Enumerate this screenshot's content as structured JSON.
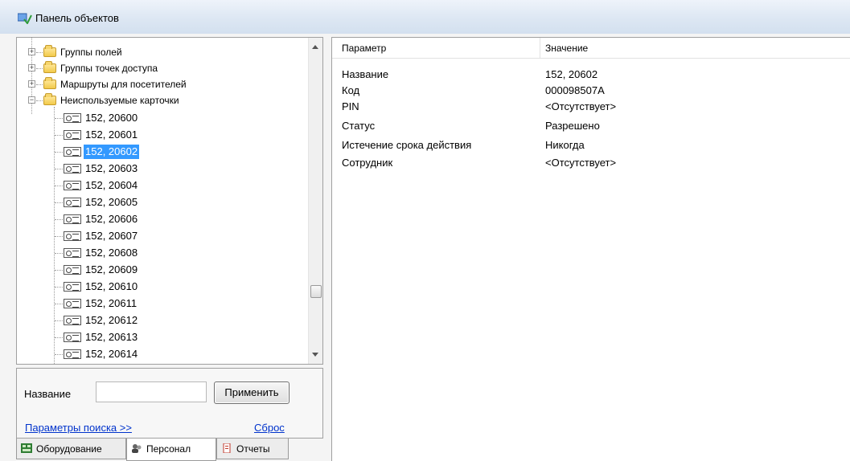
{
  "window": {
    "title": "Панель объектов",
    "icon": "panel-icon"
  },
  "tree": {
    "folders": [
      {
        "label": "Группы полей",
        "expanded": false
      },
      {
        "label": "Группы точек доступа",
        "expanded": false
      },
      {
        "label": "Маршруты для посетителей",
        "expanded": false
      },
      {
        "label": "Неиспользуемые карточки",
        "expanded": true
      }
    ],
    "cards": [
      "152, 20600",
      "152, 20601",
      "152, 20602",
      "152, 20603",
      "152, 20604",
      "152, 20605",
      "152, 20606",
      "152, 20607",
      "152, 20608",
      "152, 20609",
      "152, 20610",
      "152, 20611",
      "152, 20612",
      "152, 20613",
      "152, 20614"
    ],
    "selected_card": "152, 20602"
  },
  "search": {
    "name_label": "Название",
    "name_value": "",
    "apply_label": "Применить",
    "params_link": "Параметры поиска >>",
    "reset_link": "Сброс"
  },
  "tabs": [
    {
      "label": "Оборудование",
      "icon": "equipment-icon",
      "active": false
    },
    {
      "label": "Персонал",
      "icon": "personnel-icon",
      "active": true
    },
    {
      "label": "Отчеты",
      "icon": "reports-icon",
      "active": false
    }
  ],
  "properties": {
    "col_param": "Параметр",
    "col_value": "Значение",
    "rows": [
      {
        "key": "Название",
        "value": "152, 20602"
      },
      {
        "key": "Код",
        "value": "000098507A"
      },
      {
        "key": "PIN",
        "value": "<Отсутствует>"
      },
      {
        "key": "Статус",
        "value": "Разрешено"
      },
      {
        "key": "Истечение срока действия",
        "value": "Никогда"
      },
      {
        "key": "Сотрудник",
        "value": "<Отсутствует>"
      }
    ]
  },
  "colors": {
    "selection": "#3399ff",
    "link": "#0033cc",
    "titlebar": "#dde7f3"
  }
}
